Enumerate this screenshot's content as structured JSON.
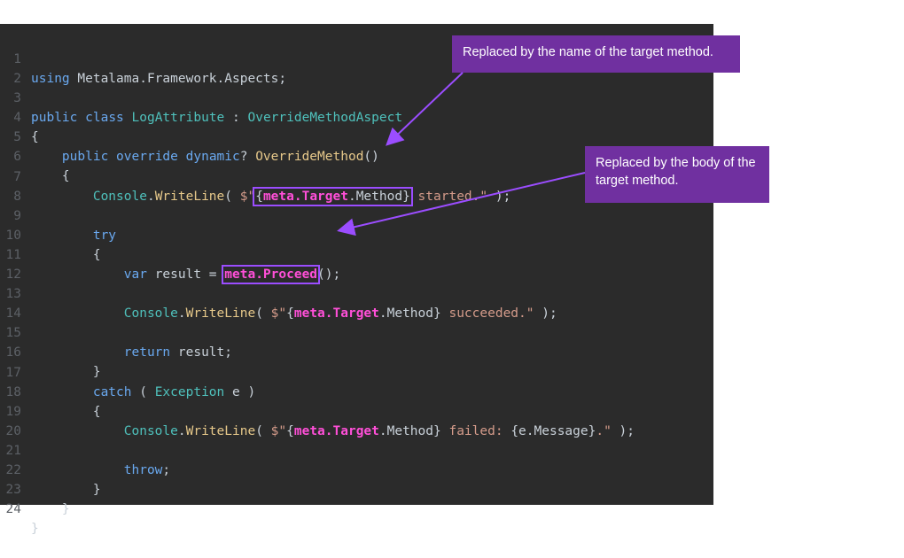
{
  "code": {
    "line_numbers": [
      "1",
      "2",
      "3",
      "4",
      "5",
      "6",
      "7",
      "8",
      "9",
      "10",
      "11",
      "12",
      "13",
      "14",
      "15",
      "16",
      "17",
      "18",
      "19",
      "20",
      "21",
      "22",
      "23",
      "24"
    ],
    "l1": {
      "kw": "using",
      "rest": " Metalama.Framework.Aspects;"
    },
    "l3": {
      "kw1": "public",
      "kw2": "class",
      "name": "LogAttribute",
      "colon": " : ",
      "base": "OverrideMethodAspect"
    },
    "l4": {
      "brace": "{"
    },
    "l5": {
      "kw1": "public",
      "kw2": "override",
      "kw3": "dynamic",
      "q": "?",
      "fn": "OverrideMethod",
      "paren": "()"
    },
    "l6": {
      "brace": "{"
    },
    "l7": {
      "cls": "Console",
      "dot": ".",
      "fn": "WriteLine",
      "open": "( ",
      "dollar": "$\"",
      "b1": "{",
      "meta": "meta.Target",
      "member": ".Method",
      "b2": "}",
      "tail": " started.\"",
      "close": " );"
    },
    "l9": {
      "kw": "try"
    },
    "l10": {
      "brace": "{"
    },
    "l11": {
      "kw": "var",
      "mid": " result = ",
      "meta": "meta.Proceed",
      "paren": "()",
      "semi": ";"
    },
    "l13": {
      "cls": "Console",
      "dot": ".",
      "fn": "WriteLine",
      "open": "( ",
      "dollar": "$\"",
      "b1": "{",
      "meta": "meta.Target",
      "member": ".Method",
      "b2": "}",
      "tail": " succeeded.\"",
      "close": " );"
    },
    "l15": {
      "kw": "return",
      "rest": " result;"
    },
    "l16": {
      "brace": "}"
    },
    "l17": {
      "kw": "catch",
      "open": " ( ",
      "type": "Exception",
      "rest": " e )"
    },
    "l18": {
      "brace": "{"
    },
    "l19": {
      "cls": "Console",
      "dot": ".",
      "fn": "WriteLine",
      "open": "( ",
      "dollar": "$\"",
      "b1": "{",
      "meta": "meta.Target",
      "member": ".Method",
      "b2": "}",
      "tail": " failed: ",
      "expr": "{e.Message}",
      "tail2": ".\"",
      "close": " );"
    },
    "l21": {
      "kw": "throw",
      "semi": ";"
    },
    "l22": {
      "brace": "}"
    },
    "l23": {
      "brace": "}"
    },
    "l24": {
      "brace": "}"
    }
  },
  "callouts": {
    "method_name": "Replaced by the name of the target method.",
    "method_body": "Replaced by the body of the target method."
  },
  "colors": {
    "background": "#2b2b2b",
    "keyword": "#6aa9f0",
    "type": "#4fc1bc",
    "function": "#e6c88a",
    "string": "#d49b8a",
    "meta": "#ff4fd8",
    "callout_bg": "#7030a0",
    "highlight": "#9b4dff"
  }
}
